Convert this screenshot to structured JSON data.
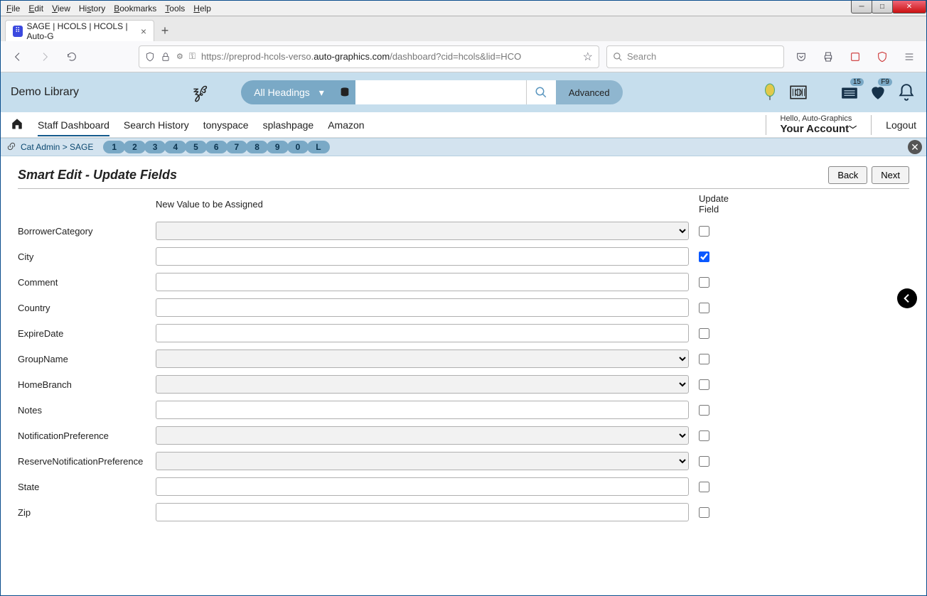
{
  "os_menu": [
    "File",
    "Edit",
    "View",
    "History",
    "Bookmarks",
    "Tools",
    "Help"
  ],
  "browser": {
    "tab_title": "SAGE | HCOLS | HCOLS | Auto-G",
    "url_prefix": "https://preprod-hcols-verso.",
    "url_host": "auto-graphics.com",
    "url_path": "/dashboard?cid=hcols&lid=HCO",
    "search_placeholder": "Search"
  },
  "app_header": {
    "library_name": "Demo Library",
    "heading_select": "All Headings",
    "advanced_label": "Advanced",
    "list_badge": "15",
    "fav_badge": "F9"
  },
  "app_nav": {
    "items": [
      "Staff Dashboard",
      "Search History",
      "tonyspace",
      "splashpage",
      "Amazon"
    ],
    "greeting_small": "Hello, Auto-Graphics",
    "greeting_big": "Your Account",
    "logout": "Logout"
  },
  "crumb": {
    "path": "Cat Admin > SAGE",
    "pills": [
      "1",
      "2",
      "3",
      "4",
      "5",
      "6",
      "7",
      "8",
      "9",
      "0",
      "L"
    ]
  },
  "page": {
    "title": "Smart Edit - Update Fields",
    "back": "Back",
    "next": "Next",
    "col_value": "New Value to be Assigned",
    "col_update": "Update Field",
    "fields": [
      {
        "label": "BorrowerCategory",
        "type": "select",
        "checked": false
      },
      {
        "label": "City",
        "type": "text",
        "checked": true
      },
      {
        "label": "Comment",
        "type": "text",
        "checked": false
      },
      {
        "label": "Country",
        "type": "text",
        "checked": false
      },
      {
        "label": "ExpireDate",
        "type": "text",
        "checked": false
      },
      {
        "label": "GroupName",
        "type": "select",
        "checked": false
      },
      {
        "label": "HomeBranch",
        "type": "select",
        "checked": false
      },
      {
        "label": "Notes",
        "type": "text",
        "checked": false
      },
      {
        "label": "NotificationPreference",
        "type": "select",
        "checked": false
      },
      {
        "label": "ReserveNotificationPreference",
        "type": "select",
        "checked": false
      },
      {
        "label": "State",
        "type": "text",
        "checked": false
      },
      {
        "label": "Zip",
        "type": "text",
        "checked": false
      }
    ]
  }
}
